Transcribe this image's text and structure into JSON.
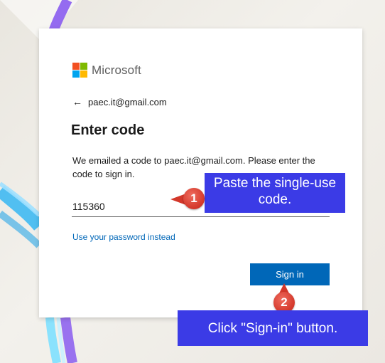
{
  "brand": {
    "name": "Microsoft",
    "logo_colors": [
      "#f25022",
      "#7fba00",
      "#00a4ef",
      "#ffb900"
    ]
  },
  "account": {
    "email": "paec.it@gmail.com",
    "back_icon": "arrow-left-icon"
  },
  "form": {
    "title": "Enter code",
    "description": "We emailed a code to paec.it@gmail.com. Please enter the code to sign in.",
    "code_value": "115360",
    "alt_link": "Use your password instead",
    "submit_label": "Sign in"
  },
  "annotations": [
    {
      "number": "1",
      "text": "Paste the single-use code."
    },
    {
      "number": "2",
      "text": "Click \"Sign-in\" button."
    }
  ],
  "colors": {
    "accent": "#0067b8",
    "annotation_box": "#3b3be6",
    "annotation_badge": "#d3372a"
  }
}
